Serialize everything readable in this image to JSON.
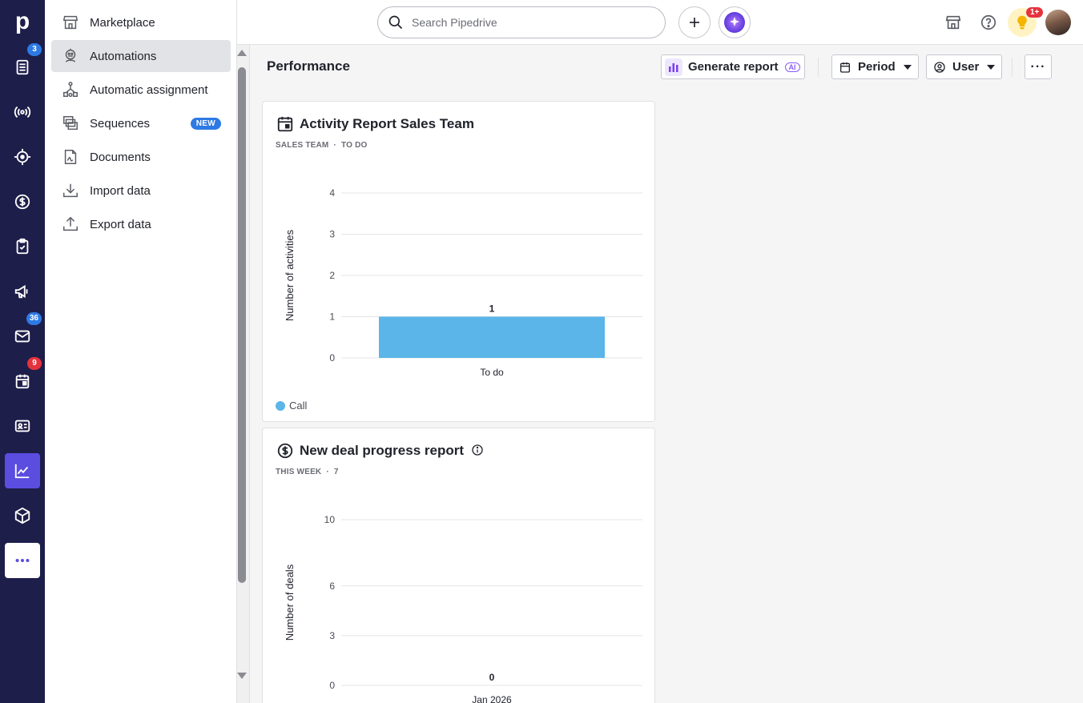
{
  "rail": {
    "logo": "p",
    "items": [
      {
        "icon": "leads-inbox-icon",
        "badge": "3",
        "badge_color": "#2d7ae5"
      },
      {
        "icon": "campaigns-broadcast-icon",
        "badge": null
      },
      {
        "icon": "target-icon",
        "badge": null
      },
      {
        "icon": "deals-dollar-icon",
        "badge": null
      },
      {
        "icon": "activities-clipboard-icon",
        "badge": null
      },
      {
        "icon": "megaphone-icon",
        "badge": null
      },
      {
        "icon": "mail-icon",
        "badge": "36",
        "badge_color": "#2d7ae5"
      },
      {
        "icon": "calendar-icon",
        "badge": "9",
        "badge_color": "#e5333d"
      },
      {
        "icon": "contacts-card-icon",
        "badge": null
      },
      {
        "icon": "insights-chart-icon",
        "badge": null,
        "active": true
      },
      {
        "icon": "products-box-icon",
        "badge": null
      },
      {
        "icon": "more-icon",
        "badge": null
      }
    ]
  },
  "flyout": {
    "items": [
      {
        "label": "Marketplace",
        "icon": "store-icon"
      },
      {
        "label": "Automations",
        "icon": "robot-icon",
        "active": true
      },
      {
        "label": "Automatic assignment",
        "icon": "assignment-icon"
      },
      {
        "label": "Sequences",
        "icon": "sequences-icon",
        "badge": "NEW"
      },
      {
        "label": "Documents",
        "icon": "document-icon"
      },
      {
        "label": "Import data",
        "icon": "import-icon"
      },
      {
        "label": "Export data",
        "icon": "export-icon"
      }
    ]
  },
  "topbar": {
    "search_placeholder": "Search Pipedrive",
    "bulb_badge": "1+"
  },
  "header": {
    "title": "Performance",
    "generate_report": "Generate report",
    "ai_badge": "AI",
    "period": "Period",
    "user": "User",
    "more": "···"
  },
  "colors": {
    "accent": "#5b4de0",
    "bar": "#5bb5e8",
    "rail": "#1e1e4b"
  },
  "cards": [
    {
      "title": "Activity Report Sales Team",
      "subtitle_a": "SALES TEAM",
      "subtitle_b": "TO DO",
      "legend": "Call"
    },
    {
      "title": "New deal progress report",
      "subtitle_a": "THIS WEEK",
      "subtitle_b": "7"
    }
  ],
  "chart_data": [
    {
      "type": "bar",
      "title": "Activity Report Sales Team",
      "ylabel": "Number of activities",
      "xlabel": "",
      "categories": [
        "To do"
      ],
      "series": [
        {
          "name": "Call",
          "values": [
            1
          ]
        }
      ],
      "yticks": [
        0,
        1,
        2,
        3,
        4
      ],
      "ylim": [
        0,
        4
      ],
      "data_labels": [
        "1"
      ],
      "grid": true,
      "legend": "bottom-left"
    },
    {
      "type": "bar",
      "title": "New deal progress report",
      "ylabel": "Number of deals",
      "xlabel": "",
      "categories": [
        "Jan 2026"
      ],
      "series": [
        {
          "values": [
            0
          ]
        }
      ],
      "yticks": [
        0,
        3,
        6,
        10
      ],
      "ylim": [
        0,
        10
      ],
      "data_labels": [
        "0"
      ],
      "grid": true
    }
  ]
}
